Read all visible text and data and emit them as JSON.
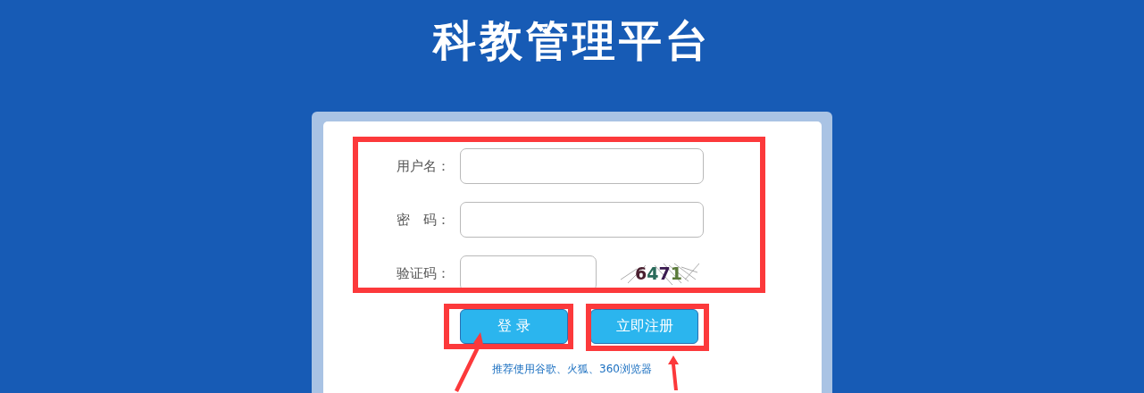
{
  "title": "科教管理平台",
  "fields": [
    {
      "label": "用户名：",
      "kind": "text"
    },
    {
      "label": "密　码：",
      "kind": "password"
    },
    {
      "label": "验证码：",
      "kind": "captcha",
      "captcha": "6471"
    }
  ],
  "buttons": [
    "登 录",
    "立即注册"
  ],
  "tip": "推荐使用谷歌、火狐、360浏览器"
}
